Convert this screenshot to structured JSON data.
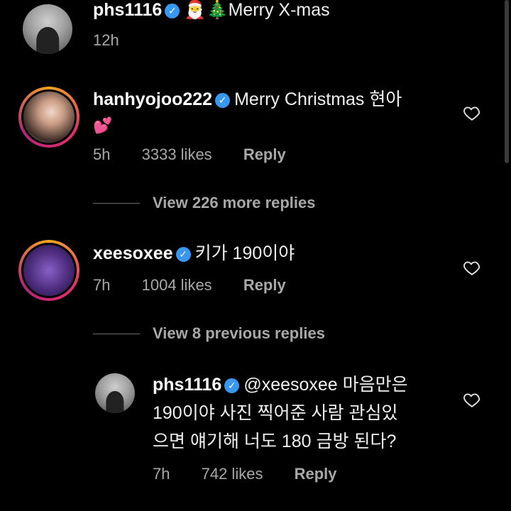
{
  "comments": [
    {
      "username": "phs1116",
      "text": "🎅🎄Merry X-mas",
      "time": "12h"
    },
    {
      "username": "hanhyojoo222",
      "text_line1": "Merry Christmas 현아",
      "text_line2": "💕",
      "time": "5h",
      "likes": "3333 likes",
      "reply": "Reply",
      "view_more": "View 226 more replies"
    },
    {
      "username": "xeesoxee",
      "text": "키가 190이야",
      "time": "7h",
      "likes": "1004 likes",
      "reply": "Reply",
      "view_previous": "View 8 previous replies"
    },
    {
      "username": "phs1116",
      "text_line1": "@xeesoxee 마음만은",
      "text_line2": "190이야 사진 찍어준 사람 관심있",
      "text_line3": "으면 얘기해 너도 180 금방 된다?",
      "time": "7h",
      "likes": "742 likes",
      "reply": "Reply"
    }
  ],
  "icons": {
    "verified": "verified-badge-icon",
    "heart": "heart-outline-icon"
  },
  "colors": {
    "background": "#000000",
    "verified": "#3897f0",
    "muted": "#a8a8a8"
  }
}
